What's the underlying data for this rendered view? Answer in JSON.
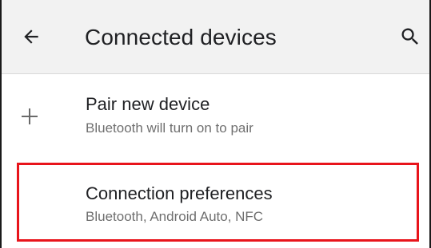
{
  "toolbar": {
    "back_icon": "arrow-back-icon",
    "title": "Connected devices",
    "search_icon": "search-icon"
  },
  "items": [
    {
      "icon": "plus-icon",
      "title": "Pair new device",
      "subtitle": "Bluetooth will turn on to pair"
    },
    {
      "icon": "",
      "title": "Connection preferences",
      "subtitle": "Bluetooth, Android Auto, NFC",
      "highlighted": true
    }
  ],
  "colors": {
    "toolbar_bg": "#f2f2f2",
    "text_primary": "#202124",
    "text_secondary": "#6f6f6f",
    "highlight": "#e8141b"
  }
}
